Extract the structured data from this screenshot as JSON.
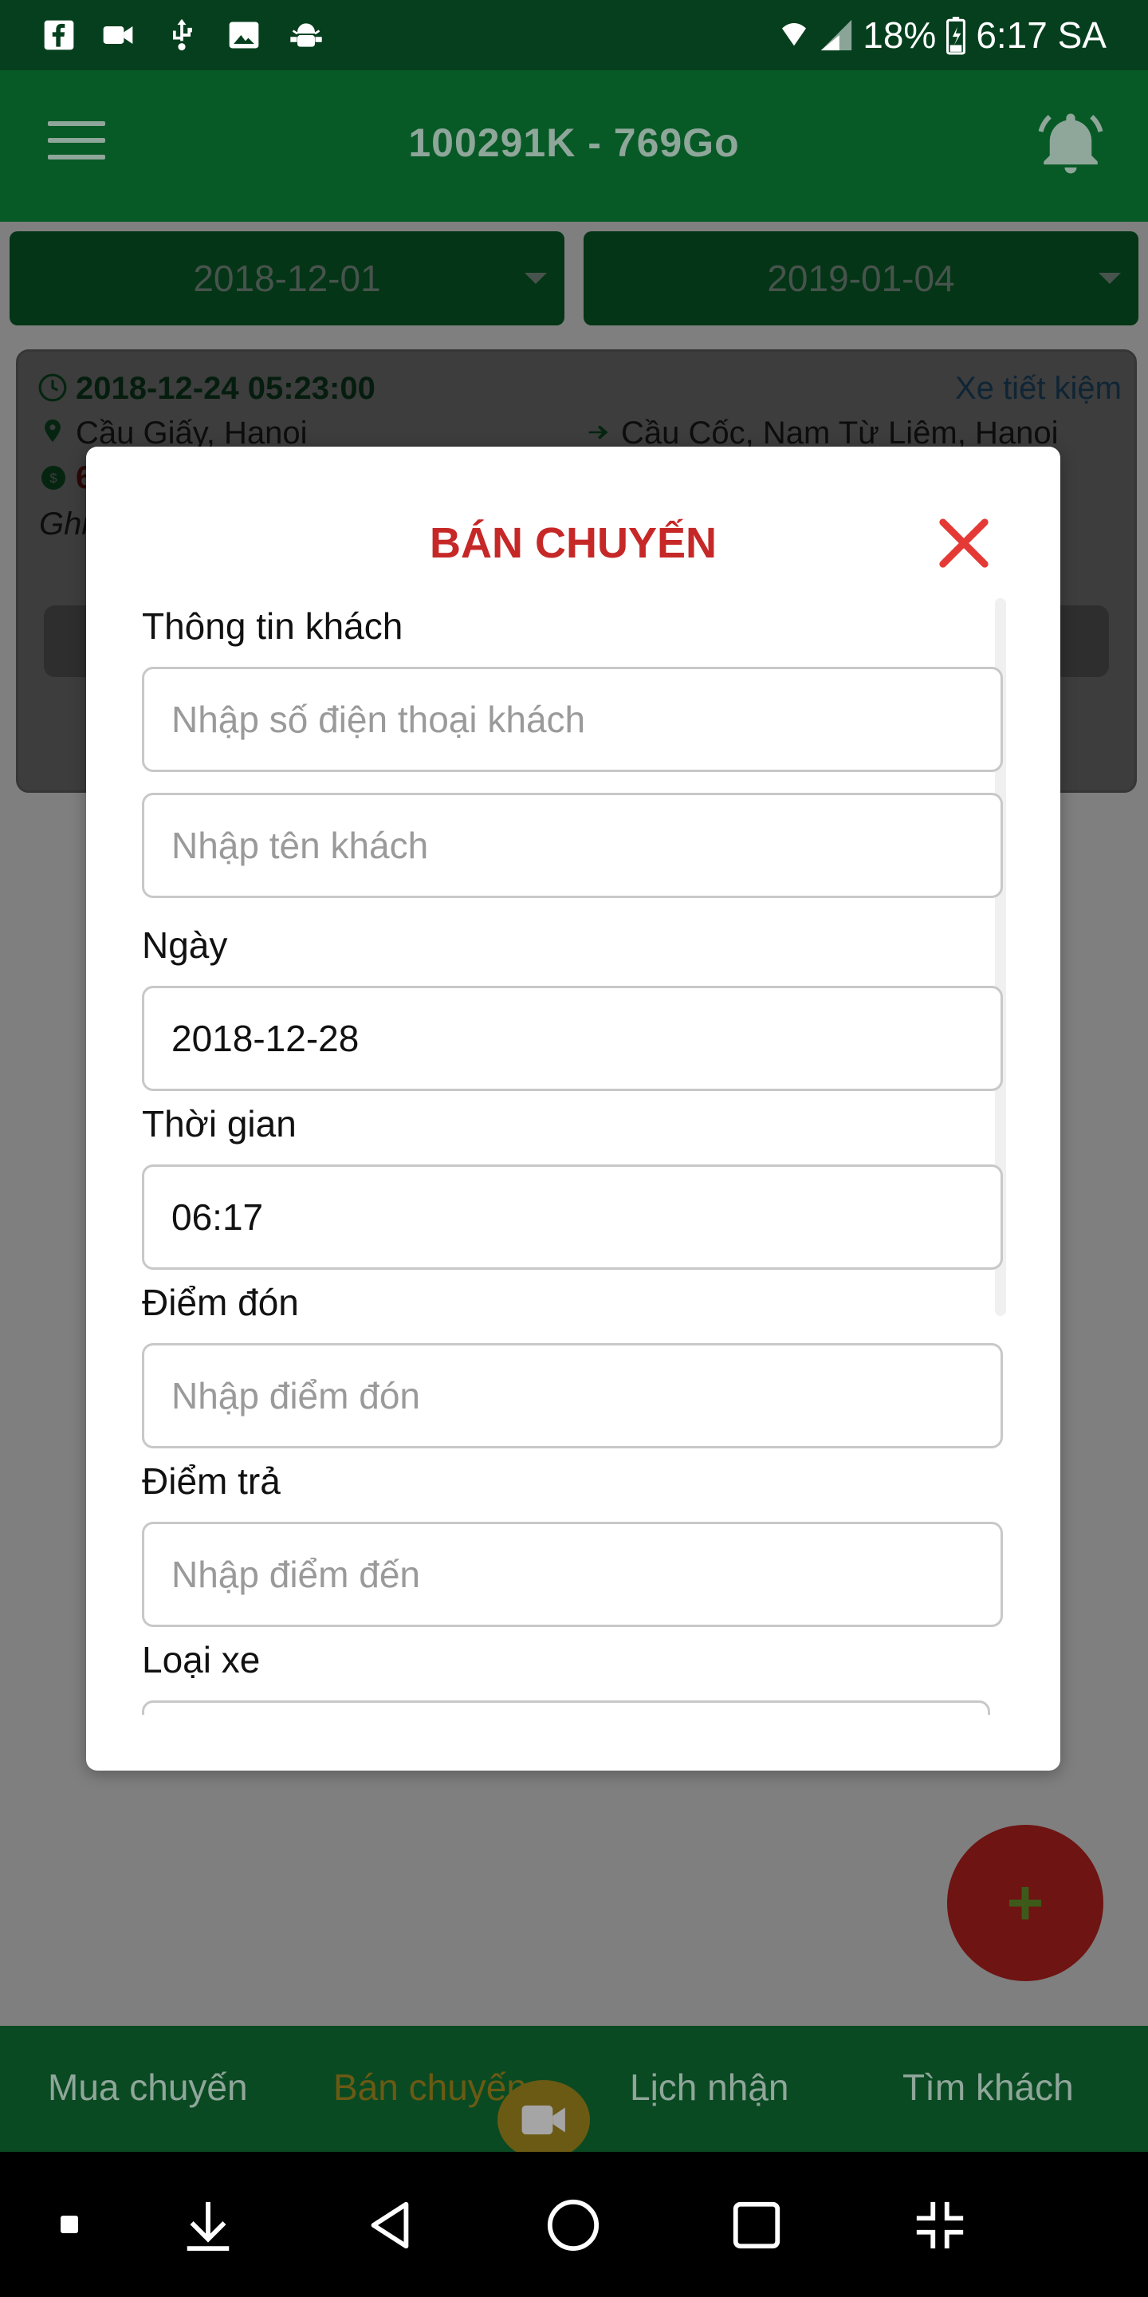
{
  "status_bar": {
    "battery": "18%",
    "time": "6:17 SA"
  },
  "header": {
    "title": "100291K  -  769Go"
  },
  "filters": {
    "start_date": "2018-12-01",
    "end_date": "2019-01-04"
  },
  "trip_card": {
    "datetime": "2018-12-24 05:23:00",
    "vehicle_type": "Xe tiết kiệm",
    "from": "Cầu Giấy, Hanoi",
    "to": "Cầu Cốc, Nam Từ Liêm, Hanoi",
    "price_partial": "6",
    "note_partial": "Ghi"
  },
  "modal": {
    "title": "BÁN CHUYẾN",
    "customer_label": "Thông tin khách",
    "phone_placeholder": "Nhập số điện thoại khách",
    "name_placeholder": "Nhập tên khách",
    "date_label": "Ngày",
    "date_value": "2018-12-28",
    "time_label": "Thời gian",
    "time_value": "06:17",
    "pickup_label": "Điểm đón",
    "pickup_placeholder": "Nhập điểm đón",
    "dropoff_label": "Điểm trả",
    "dropoff_placeholder": "Nhập điểm đến",
    "vehicle_label": "Loại xe"
  },
  "bottom_nav": {
    "items": [
      "Mua chuyến",
      "Bán chuyến",
      "Lịch nhận",
      "Tìm khách"
    ],
    "active_index": 1
  },
  "colors": {
    "primary_dark": "#053f1e",
    "primary": "#075a26",
    "accent_red": "#c62828",
    "active_tab": "#c9a227"
  }
}
